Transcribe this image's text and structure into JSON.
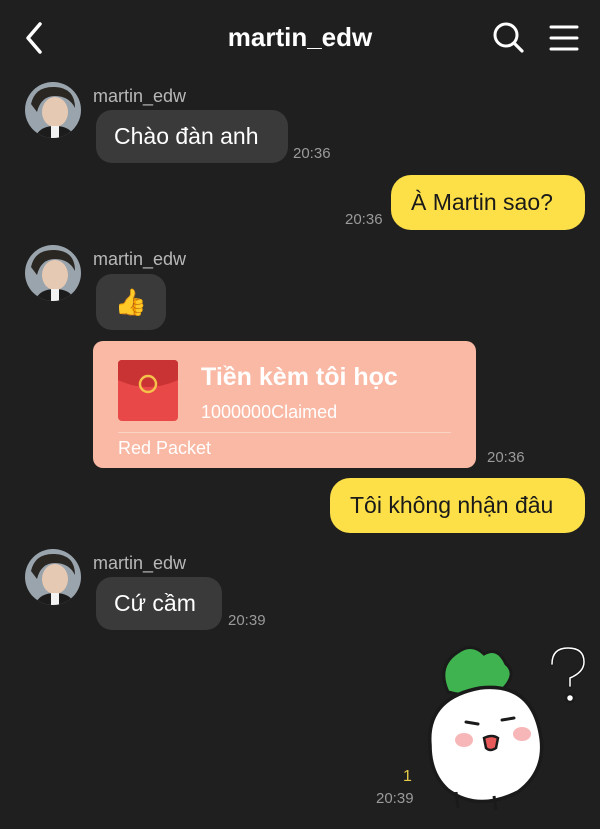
{
  "header": {
    "title": "martin_edw"
  },
  "messages": {
    "m1": {
      "sender": "martin_edw",
      "text": "Chào đàn anh",
      "time": "20:36"
    },
    "m2": {
      "text": "À Martin sao?",
      "time": "20:36"
    },
    "m3": {
      "sender": "martin_edw",
      "emoji": "👍"
    },
    "packet": {
      "title": "Tiền kèm tôi học",
      "amount": "1000000Claimed",
      "label": "Red Packet",
      "time": "20:36"
    },
    "m4": {
      "text": "Tôi không nhận đâu"
    },
    "m5": {
      "sender": "martin_edw",
      "text": "Cứ cầm",
      "time": "20:39"
    },
    "sticker": {
      "read_count": "1",
      "time": "20:39"
    }
  },
  "colors": {
    "background": "#1f1f1f",
    "incoming_bubble": "#3a3a3a",
    "outgoing_bubble": "#fde047",
    "red_packet": "#f9b9a4"
  }
}
